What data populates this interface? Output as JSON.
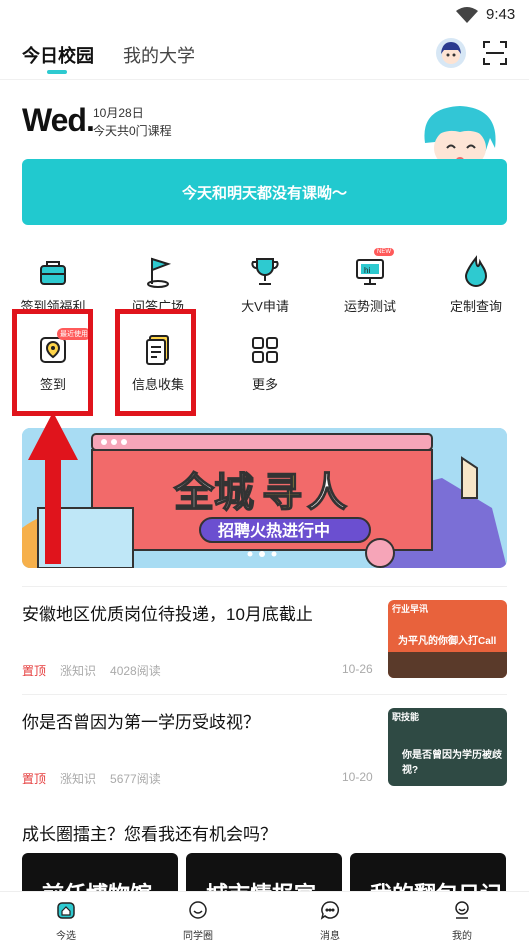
{
  "status": {
    "time": "9:43"
  },
  "nav": {
    "tab_active": "今日校园",
    "tab_other": "我的大学"
  },
  "today": {
    "weekday": "Wed.",
    "date": "10月28日",
    "courses": "今天共0门课程"
  },
  "schedule_banner": "今天和明天都没有课呦～",
  "grid": {
    "row1": [
      "签到领福利",
      "问答广场",
      "大V申请",
      "运势测试",
      "定制查询"
    ],
    "row2": [
      "签到",
      "信息收集",
      "更多"
    ],
    "badge_checkin": "最近使用",
    "badge_new": "NEW"
  },
  "promo": {
    "title_a": "全城",
    "title_b": "寻",
    "title_c": "人",
    "subtitle": "招聘火热进行中"
  },
  "articles": [
    {
      "title": "安徽地区优质岗位待投递，10月底截止",
      "pin": "置顶",
      "tag": "涨知识",
      "reads": "4028阅读",
      "date": "10-26",
      "thumb_tag": "行业早讯",
      "thumb_text": "为平凡的你御入打Call"
    },
    {
      "title": "你是否曾因为第一学历受歧视？",
      "pin": "置顶",
      "tag": "涨知识",
      "reads": "5677阅读",
      "date": "10-20",
      "thumb_tag": "职技能",
      "thumb_text": "你是否曾因为学历被歧视?"
    }
  ],
  "section": {
    "title": "成长圈擂主？您看我还有机会吗？"
  },
  "cards": [
    "前任博物馆",
    "城市情报官",
    "我的翻包日记"
  ],
  "bottom_nav": [
    "今选",
    "同学圈",
    "消息",
    "我的"
  ],
  "colors": {
    "accent": "#21c9cf",
    "highlight": "#e0141c",
    "pin": "#e53b3b"
  }
}
